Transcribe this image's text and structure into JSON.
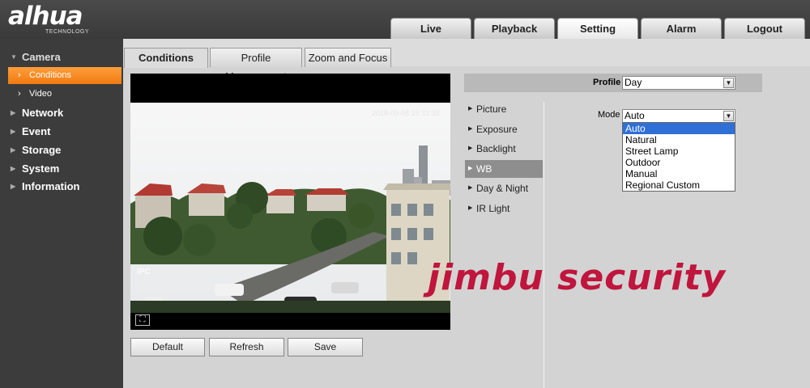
{
  "logo": {
    "brand": "alhua",
    "tagline": "TECHNOLOGY"
  },
  "nav": {
    "tabs": [
      {
        "label": "Live"
      },
      {
        "label": "Playback"
      },
      {
        "label": "Setting"
      },
      {
        "label": "Alarm"
      },
      {
        "label": "Logout"
      }
    ],
    "active": "Setting"
  },
  "sidebar": {
    "camera": "Camera",
    "conditions": "Conditions",
    "video": "Video",
    "network": "Network",
    "event": "Event",
    "storage": "Storage",
    "system": "System",
    "information": "Information"
  },
  "content_tabs": [
    "Conditions",
    "Profile Management",
    "Zoom and Focus"
  ],
  "video": {
    "timestamp": "2018-09-08 15:33:38",
    "camera_label": "IPC"
  },
  "buttons": {
    "default": "Default",
    "refresh": "Refresh",
    "save": "Save"
  },
  "profile": {
    "label": "Profile",
    "value": "Day"
  },
  "settings_menu": [
    "Picture",
    "Exposure",
    "Backlight",
    "WB",
    "Day & Night",
    "IR Light"
  ],
  "settings_menu_active": "WB",
  "mode": {
    "label": "Mode",
    "value": "Auto",
    "options": [
      "Auto",
      "Natural",
      "Street Lamp",
      "Outdoor",
      "Manual",
      "Regional Custom"
    ],
    "highlighted": "Auto"
  },
  "watermark": "jimbu security",
  "icons": {
    "dropdown": "chevron-down-icon",
    "fullscreen": "fullscreen-icon",
    "expand": "triangle-right-icon",
    "collapse": "triangle-down-icon"
  },
  "colors": {
    "header_bg": "#3f3f3f",
    "sidebar_bg": "#3c3c3c",
    "active_orange": "#f58a24",
    "highlight_blue": "#2f6fd6",
    "watermark_red": "#c0153d"
  }
}
